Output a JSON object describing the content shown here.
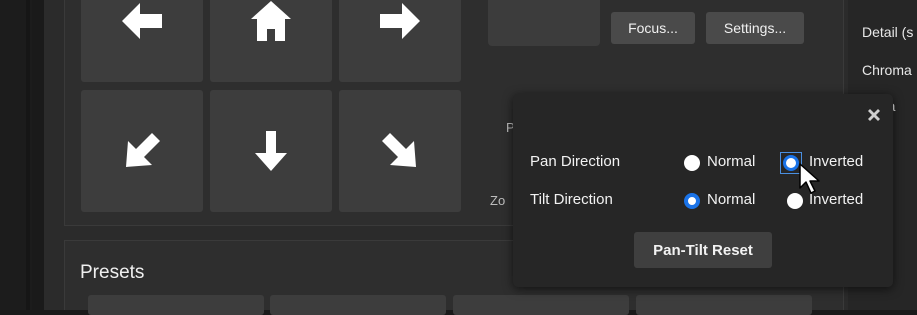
{
  "camera_controls": {
    "buttons": {
      "focus_label": "Focus...",
      "settings_label": "Settings..."
    },
    "direction_pad": [
      {
        "name": "pan-left",
        "icon": "arrow-left-icon"
      },
      {
        "name": "home",
        "icon": "home-icon"
      },
      {
        "name": "pan-right",
        "icon": "arrow-right-icon"
      },
      {
        "name": "down-left",
        "icon": "arrow-down-left-icon"
      },
      {
        "name": "down",
        "icon": "arrow-down-icon"
      },
      {
        "name": "down-right",
        "icon": "arrow-down-right-icon"
      }
    ],
    "partial_labels": {
      "p": "P",
      "zo": "Zo"
    }
  },
  "right_panel": {
    "labels": [
      "Detail (s",
      "Chroma",
      "ma"
    ]
  },
  "presets": {
    "title": "Presets"
  },
  "pan_tilt_popup": {
    "close_icon": "close-x-icon",
    "rows": [
      {
        "label": "Pan Direction",
        "options": [
          {
            "label": "Normal",
            "selected": false
          },
          {
            "label": "Inverted",
            "selected": false,
            "focused": true
          }
        ]
      },
      {
        "label": "Tilt Direction",
        "options": [
          {
            "label": "Normal",
            "selected": true
          },
          {
            "label": "Inverted",
            "selected": false
          }
        ]
      }
    ],
    "reset_label": "Pan-Tilt Reset"
  },
  "colors": {
    "accent": "#1a73e8",
    "panel": "#2b2b2b",
    "button": "#3d3d3d",
    "popup": "#262626"
  }
}
